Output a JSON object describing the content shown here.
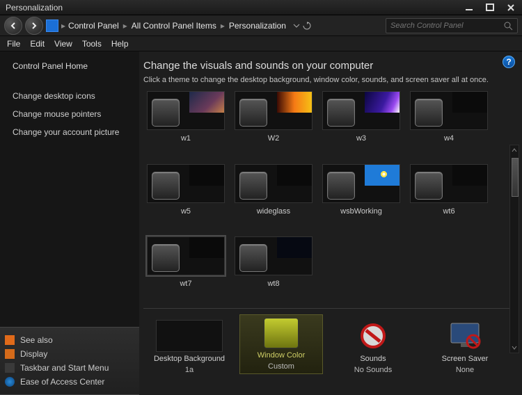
{
  "window": {
    "title": "Personalization"
  },
  "breadcrumb": {
    "items": [
      "Control Panel",
      "All Control Panel Items",
      "Personalization"
    ]
  },
  "search": {
    "placeholder": "Search Control Panel"
  },
  "menubar": [
    "File",
    "Edit",
    "View",
    "Tools",
    "Help"
  ],
  "sidebar": {
    "heading": "Control Panel Home",
    "links": [
      "Change desktop icons",
      "Change mouse pointers",
      "Change your account picture"
    ]
  },
  "seealso": {
    "heading": "See also",
    "items": [
      "Display",
      "Taskbar and Start Menu",
      "Ease of Access Center"
    ]
  },
  "content": {
    "heading": "Change the visuals and sounds on your computer",
    "subtext": "Click a theme to change the desktop background, window color, sounds, and screen saver all at once."
  },
  "themes": [
    {
      "name": "w1",
      "wall": "linear-gradient(135deg,#1e2a4a 0%,#6a3a5a 60%,#c58048 100%)",
      "selected": false
    },
    {
      "name": "W2",
      "wall": "linear-gradient(90deg,#3a0b04,#f67a15,#f6c015)",
      "selected": false
    },
    {
      "name": "w3",
      "wall": "linear-gradient(115deg,#0b0640,#3b1aa0 55%,#9a4af0 80%,#fff 100%)",
      "selected": false
    },
    {
      "name": "w4",
      "wall": "#0b0b0b",
      "selected": false
    },
    {
      "name": "w5",
      "wall": "#0a0a0a",
      "selected": false
    },
    {
      "name": "wideglass",
      "wall": "#0a0a0a",
      "selected": false
    },
    {
      "name": "wsbWorking",
      "wall": "radial-gradient(circle at 55% 45%, #fff 0 6%, #ffe44a 6% 14%, #1f7bd8 14% 100%)",
      "selected": false
    },
    {
      "name": "wt6",
      "wall": "#0b0b0b",
      "selected": false
    },
    {
      "name": "wt7",
      "wall": "#0a0a0a",
      "selected": true
    },
    {
      "name": "wt8",
      "wall": "#060912",
      "selected": false
    }
  ],
  "settings": {
    "background": {
      "label": "Desktop Background",
      "value": "1a"
    },
    "color": {
      "label": "Window Color",
      "value": "Custom",
      "swatch": "linear-gradient(#c3cc30,#6e7410)"
    },
    "sounds": {
      "label": "Sounds",
      "value": "No Sounds"
    },
    "saver": {
      "label": "Screen Saver",
      "value": "None"
    }
  }
}
